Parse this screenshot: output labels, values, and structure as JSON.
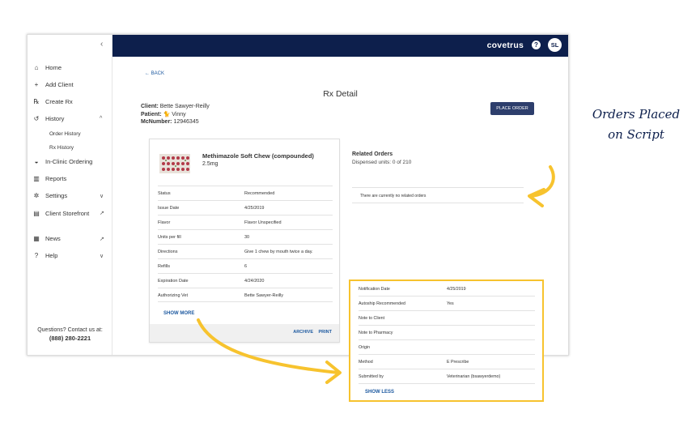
{
  "sidebar": {
    "collapse_glyph": "‹",
    "items": [
      {
        "label": "Home",
        "icon": "home-icon",
        "glyph": "⌂"
      },
      {
        "label": "Add Client",
        "icon": "add-client-icon",
        "glyph": "+"
      },
      {
        "label": "Create Rx",
        "icon": "create-rx-icon",
        "glyph": "℞"
      },
      {
        "label": "History",
        "icon": "history-icon",
        "glyph": "↺",
        "caret": "^"
      },
      {
        "label": "In-Clinic Ordering",
        "icon": "basket-icon",
        "glyph": "◒"
      },
      {
        "label": "Reports",
        "icon": "reports-icon",
        "glyph": "▥"
      },
      {
        "label": "Settings",
        "icon": "gear-icon",
        "glyph": "✲",
        "caret": "∨"
      },
      {
        "label": "Client Storefront",
        "icon": "storefront-icon",
        "glyph": "▤",
        "caret": "↗"
      },
      {
        "label": "News",
        "icon": "news-icon",
        "glyph": "▦",
        "caret": "↗"
      },
      {
        "label": "Help",
        "icon": "help-icon",
        "glyph": "?",
        "caret": "∨"
      }
    ],
    "history_sub": [
      "Order History",
      "Rx History"
    ],
    "contact_text": "Questions? Contact us at:",
    "contact_phone": "(888) 280-2221"
  },
  "topbar": {
    "logo": "covetrus",
    "help_glyph": "?",
    "avatar_initials": "SL",
    "bg_color": "#0d1f4c"
  },
  "page": {
    "back_label": "← BACK",
    "title": "Rx Detail",
    "client_label": "Client:",
    "client_value": "Bette Sawyer-Reilly",
    "patient_label": "Patient:",
    "patient_value": "Vinny",
    "mcnumber_label": "McNumber:",
    "mcnumber_value": "12946345",
    "place_order_label": "PLACE ORDER"
  },
  "rx_card": {
    "product_name": "Methimazole Soft Chew (compounded)",
    "product_dose": "2.5mg",
    "details": [
      {
        "key": "Status",
        "value": "Recommended"
      },
      {
        "key": "Issue Date",
        "value": "4/25/2019"
      },
      {
        "key": "Flavor",
        "value": "Flavor Unspecified"
      },
      {
        "key": "Units per fill",
        "value": "30"
      },
      {
        "key": "Directions",
        "value": "Give 1 chew by mouth twice a day."
      },
      {
        "key": "Refills",
        "value": "6"
      },
      {
        "key": "Expiration Date",
        "value": "4/24/2020"
      },
      {
        "key": "Authorizing Vet",
        "value": "Bette Sawyer-Reilly"
      }
    ],
    "show_more_label": "SHOW MORE",
    "archive_label": "ARCHIVE",
    "print_label": "PRINT"
  },
  "related": {
    "title": "Related Orders",
    "units": "Dispensed units: 0 of 210",
    "empty_text": "There are currently no related orders"
  },
  "expanded_details": {
    "rows": [
      {
        "key": "Notification Date",
        "value": "4/25/2019"
      },
      {
        "key": "Autoship Recommended",
        "value": "Yes"
      },
      {
        "key": "Note to Client",
        "value": ""
      },
      {
        "key": "Note to Pharmacy",
        "value": ""
      },
      {
        "key": "Origin",
        "value": ""
      },
      {
        "key": "Method",
        "value": "E Prescribe"
      },
      {
        "key": "Submitted by",
        "value": "Veterinarian (bsawyerdemo)"
      }
    ],
    "show_less_label": "SHOW LESS",
    "highlight_color": "#f7c32e"
  },
  "annotation": {
    "line1": "Orders Placed",
    "line2": "on Script"
  }
}
